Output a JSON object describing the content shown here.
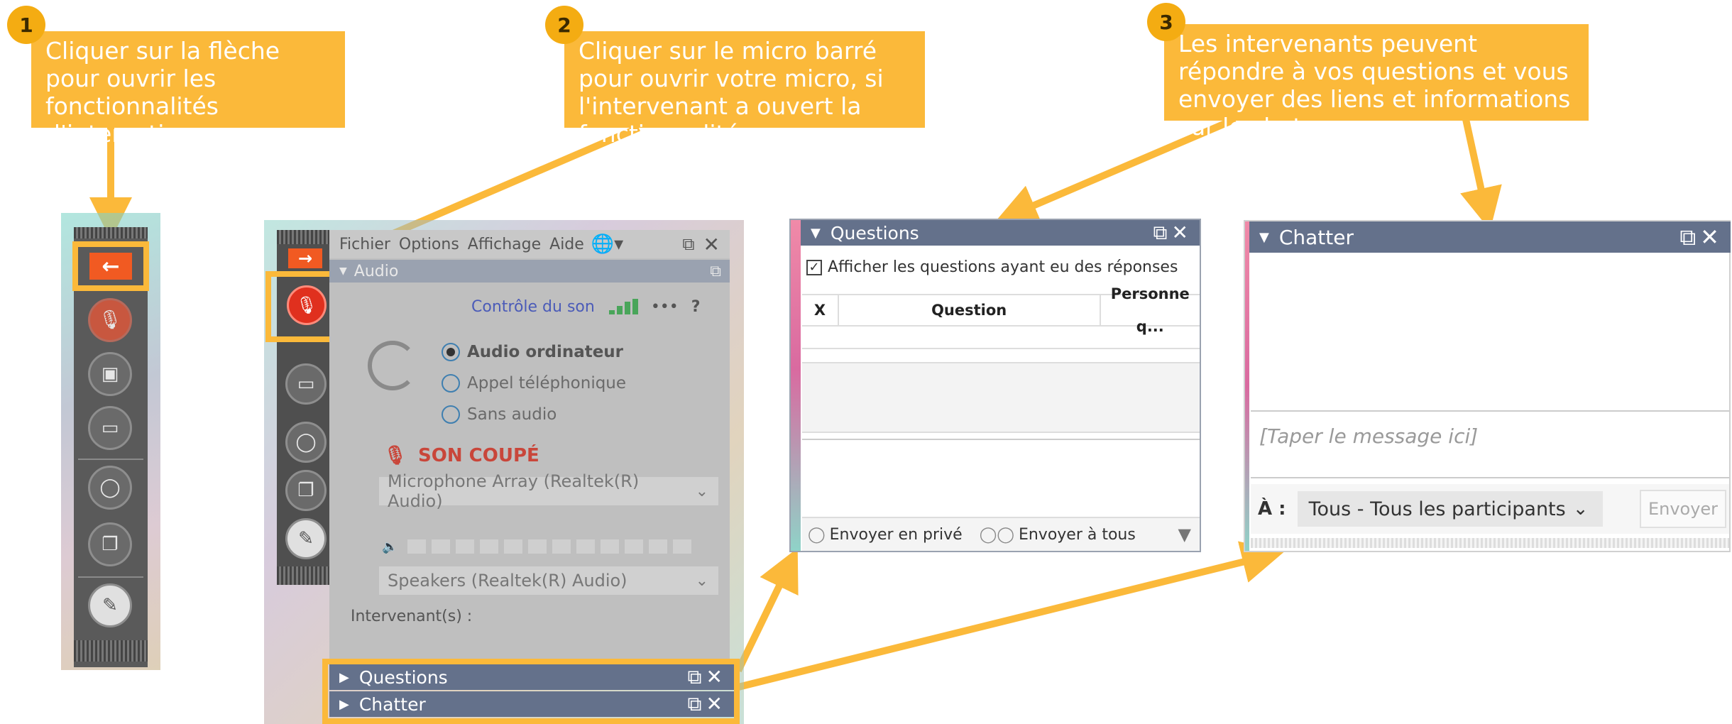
{
  "callouts": [
    {
      "number": "1",
      "text": "Cliquer sur la flèche pour ouvrir les fonctionnalités d'interaction."
    },
    {
      "number": "2",
      "text": "Cliquer sur le micro barré pour ouvrir votre micro, si l'intervenant a ouvert la fonctionnalité."
    },
    {
      "number": "3",
      "text": "Les intervenants peuvent répondre à vos questions et vous envoyer des liens et informations sur le chat."
    }
  ],
  "menu": {
    "file": "Fichier",
    "options": "Options",
    "view": "Affichage",
    "help": "Aide"
  },
  "audio_panel": {
    "title": "Audio",
    "sound_control": "Contrôle du son",
    "more": "•••",
    "help": "?",
    "options": [
      "Audio ordinateur",
      "Appel téléphonique",
      "Sans audio"
    ],
    "selected_option": "Audio ordinateur",
    "muted_status": "SON COUPÉ",
    "microphone": "Microphone Array (Realtek(R) Audio)",
    "speakers": "Speakers (Realtek(R) Audio)",
    "presenters_label": "Intervenant(s) :"
  },
  "collapsed_panels": {
    "questions": "Questions",
    "chat": "Chatter"
  },
  "questions_panel": {
    "title": "Questions",
    "show_answered": "Afficher les questions ayant eu des réponses",
    "columns": [
      "X",
      "Question",
      "Personne q..."
    ],
    "send_private": "Envoyer en privé",
    "send_all": "Envoyer à tous"
  },
  "chat_panel": {
    "title": "Chatter",
    "placeholder": "[Taper le message ici]",
    "to_label": "À :",
    "recipient": "Tous - Tous les participants",
    "send": "Envoyer"
  },
  "colors": {
    "callout": "#fbb93a",
    "badge": "#f4ac12",
    "panel_header": "#64718b",
    "mic_red": "#d8492f",
    "arrow_orange": "#f15a22"
  }
}
